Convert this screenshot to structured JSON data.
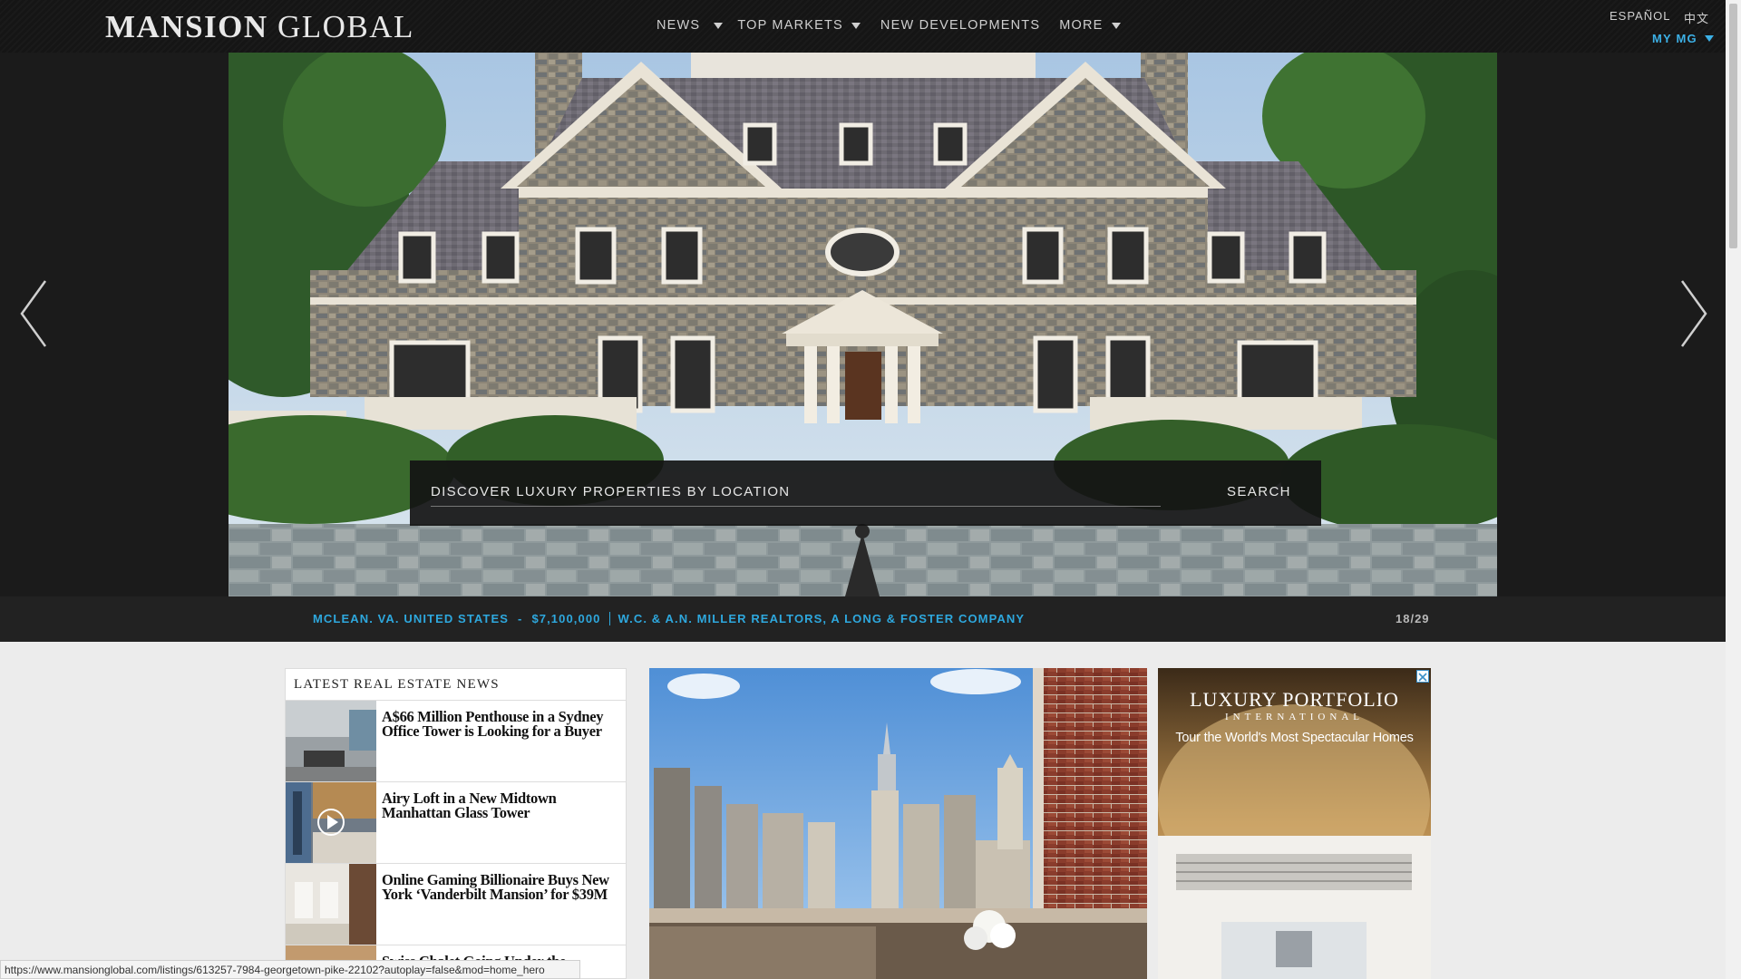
{
  "header": {
    "logo_part1": "MANSION",
    "logo_part2": " GLOBAL",
    "nav": {
      "news": "NEWS",
      "top_markets": "TOP MARKETS",
      "new_developments": "NEW DEVELOPMENTS",
      "more": "MORE"
    },
    "lang_es": "ESPAÑOL",
    "lang_zh": "中文",
    "my_mg": "MY MG"
  },
  "hero": {
    "search_placeholder": "DISCOVER LUXURY PROPERTIES BY LOCATION",
    "search_button": "SEARCH",
    "caption": {
      "location": "MCLEAN. VA. UNITED STATES",
      "dash": "-",
      "price": "$7,100,000",
      "agency": "W.C. & A.N. MILLER REALTORS, A LONG & FOSTER COMPANY",
      "counter": "18/29"
    }
  },
  "news": {
    "heading": "LATEST REAL ESTATE NEWS",
    "items": [
      {
        "title": "A$66 Million Penthouse in a Sydney Office Tower is Looking for a Buyer"
      },
      {
        "title": "Airy Loft in a New Midtown Manhattan Glass Tower"
      },
      {
        "title": "Online Gaming Billionaire Buys New York ‘Vanderbilt Mansion’ for $39M"
      },
      {
        "title": "Swiss Chalet Going Under the"
      }
    ]
  },
  "ad": {
    "brand_line1": "LUXURY PORTFOLIO",
    "brand_line2": "INTERNATIONAL",
    "tagline": "Tour the World's Most Spectacular Homes"
  },
  "status_url": "https://www.mansionglobal.com/listings/613257-7984-georgetown-pike-22102?autoplay=false&mod=home_hero",
  "colors": {
    "accent": "#2ea8de",
    "header_bg": "#151515",
    "hero_bg": "#1b1b1b"
  },
  "icons": {
    "prev": "chevron-left-icon",
    "next": "chevron-right-icon",
    "play": "play-icon",
    "close": "close-icon"
  }
}
